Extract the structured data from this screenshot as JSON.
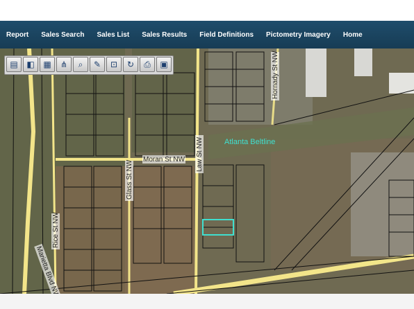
{
  "nav": {
    "items": [
      "Report",
      "Sales Search",
      "Sales List",
      "Sales Results",
      "Field Definitions",
      "Pictometry Imagery",
      "Home"
    ]
  },
  "toolbar": {
    "tools": [
      {
        "icon": "map-icon",
        "glyph": "▤"
      },
      {
        "icon": "layers-icon",
        "glyph": "◧"
      },
      {
        "icon": "aerial-icon",
        "glyph": "▦"
      },
      {
        "icon": "network-icon",
        "glyph": "⋔"
      },
      {
        "icon": "magnifier-icon",
        "glyph": "⌕"
      },
      {
        "icon": "pencil-icon",
        "glyph": "✎"
      },
      {
        "icon": "select-icon",
        "glyph": "⊡"
      },
      {
        "icon": "refresh-icon",
        "glyph": "↻"
      },
      {
        "icon": "print-icon",
        "glyph": "⎙"
      },
      {
        "icon": "save-icon",
        "glyph": "▣"
      }
    ]
  },
  "map": {
    "labels": {
      "beltline": "Atlanta Beltline",
      "moran": "Moran St NW",
      "law": "Law St NW",
      "glass": "Glass St NW",
      "hornady": "Hornady St NW",
      "rice": "Rice St NW",
      "marietta": "Marietta Blvd NW"
    },
    "colors": {
      "road": "#f3e58a",
      "highlight": "#3fe0d0",
      "beltline_text": "#3fe0d0"
    }
  }
}
